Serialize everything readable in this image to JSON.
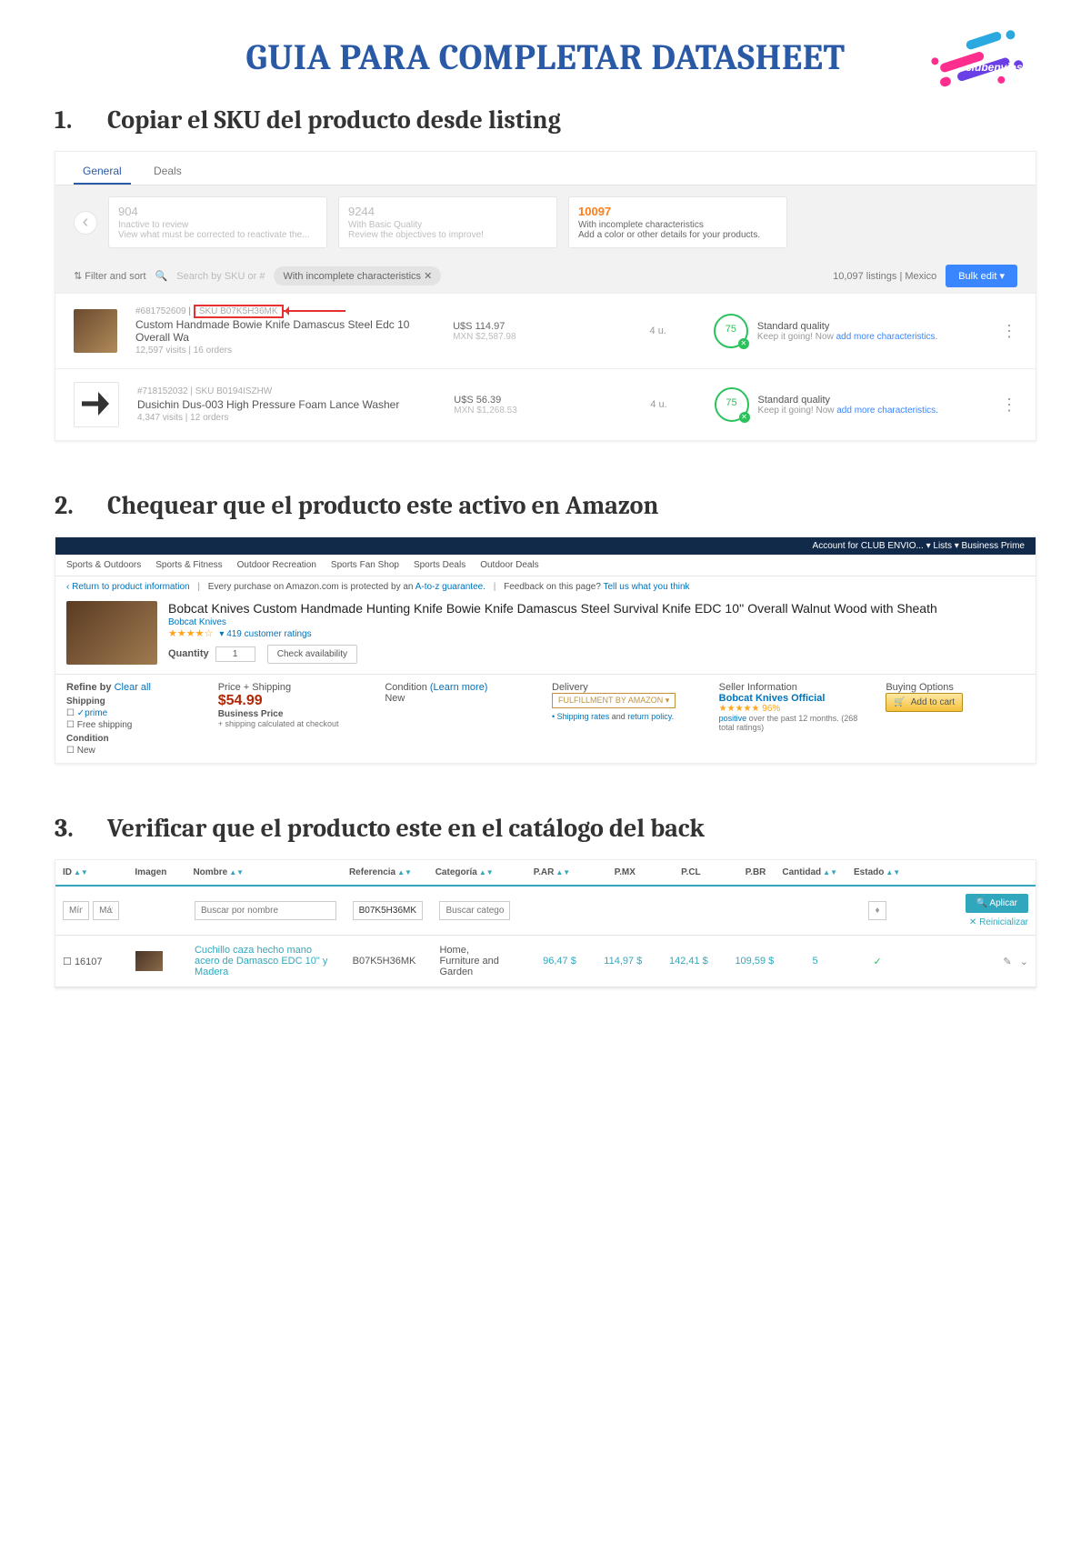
{
  "title": "GUIA PARA COMPLETAR DATASHEET",
  "logo_text": "clubenvios",
  "steps": {
    "s1": {
      "num": "1.",
      "title": "Copiar el SKU del producto desde listing"
    },
    "s2": {
      "num": "2.",
      "title": "Chequear que el producto este activo en Amazon"
    },
    "s3": {
      "num": "3.",
      "title": "Verificar que el producto este en el catálogo del back"
    }
  },
  "shot1": {
    "tabs": {
      "general": "General",
      "deals": "Deals"
    },
    "cards": [
      {
        "n": "904",
        "l1": "Inactive to review",
        "l2": "View what must be corrected to reactivate the..."
      },
      {
        "n": "9244",
        "l1": "With Basic Quality",
        "l2": "Review the objectives to improve!"
      },
      {
        "n": "10097",
        "l1": "With incomplete characteristics",
        "l2": "Add a color or other details for your products."
      }
    ],
    "filter": "Filter and sort",
    "search_placeholder": "Search by SKU or #",
    "chip": "With incomplete characteristics ✕",
    "count": "10,097 listings | Mexico",
    "bulk": "Bulk edit",
    "rows": [
      {
        "id": "#681752609",
        "sku_lbl": "SKU",
        "sku": "B07K5H36MK",
        "name": "Custom Handmade Bowie Knife Damascus Steel Edc 10 Overall Wa",
        "visits": "12,597 visits | 16 orders",
        "usd": "U$S 114.97",
        "mxn": "MXN $2,587.98",
        "units": "4 u.",
        "ring": "75",
        "q1": "Standard quality",
        "q2": "Keep it going! Now ",
        "q2a": "add more characteristics."
      },
      {
        "id": "#718152032 | SKU B0194ISZHW",
        "sku_lbl": "",
        "sku": "",
        "name": "Dusichin Dus-003 High Pressure Foam Lance Washer",
        "visits": "4,347 visits | 12 orders",
        "usd": "U$S 56.39",
        "mxn": "MXN $1,268.53",
        "units": "4 u.",
        "ring": "75",
        "q1": "Standard quality",
        "q2": "Keep it going! Now ",
        "q2a": "add more characteristics."
      }
    ]
  },
  "shot2": {
    "top_right": "Account for CLUB ENVIO... ▾   Lists ▾   Business Prime",
    "nav": [
      "Sports & Outdoors",
      "Sports & Fitness",
      "Outdoor Recreation",
      "Sports Fan Shop",
      "Sports Deals",
      "Outdoor Deals"
    ],
    "back": "‹ Return to product information",
    "guar": "Every purchase on Amazon.com is protected by an ",
    "guar_link": "A-to-z guarantee.",
    "feedback": "Feedback on this page? ",
    "feedback_link": "Tell us what you think",
    "ptitle": "Bobcat Knives Custom Handmade Hunting Knife Bowie Knife Damascus Steel Survival Knife EDC 10'' Overall Walnut Wood with Sheath",
    "brand": "Bobcat Knives",
    "ratings": "419 customer ratings",
    "qty_lbl": "Quantity",
    "qty": "1",
    "check": "Check availability",
    "refine": "Refine by ",
    "clear": "Clear all",
    "refine_ship": "Shipping",
    "prime": "✓prime",
    "free": "Free shipping",
    "cond": "Condition",
    "new": "New",
    "h_price": "Price + Shipping",
    "price": "$54.99",
    "bp": "Business Price",
    "pship": "+ shipping calculated at checkout",
    "h_cond": "Condition ",
    "h_cond_l": "(Learn more)",
    "cond_v": "New",
    "h_del": "Delivery",
    "fba": "FULFILLMENT BY AMAZON ▾",
    "ship_rates": "Shipping rates",
    "and": " and ",
    "ret": "return policy.",
    "h_seller": "Seller Information",
    "seller": "Bobcat Knives Official",
    "rate": "★★★★★ 96%",
    "pos": "positive",
    "posrest": " over the past 12 months. (268 total ratings)",
    "h_buy": "Buying Options",
    "cart": "Add to cart"
  },
  "shot3": {
    "hd": {
      "id": "ID",
      "img": "Imagen",
      "nom": "Nombre",
      "ref": "Referencia",
      "cat": "Categoría",
      "par": "P.AR",
      "pmx": "P.MX",
      "pcl": "P.CL",
      "pbr": "P.BR",
      "cant": "Cantidad",
      "est": "Estado"
    },
    "filter": {
      "min": "Mín.",
      "max": "Máx.",
      "nom": "Buscar por nombre",
      "ref": "B07K5H36MK",
      "cat": "Buscar categorí",
      "apply": "Aplicar",
      "reset": "Reinicializar"
    },
    "row": {
      "id": "16107",
      "nom": "Cuchillo caza hecho mano acero de Damasco EDC 10\" y Madera",
      "ref": "B07K5H36MK",
      "cat": "Home, Furniture and Garden",
      "par": "96,47 $",
      "pmx": "114,97 $",
      "pcl": "142,41 $",
      "pbr": "109,59 $",
      "cant": "5"
    }
  }
}
